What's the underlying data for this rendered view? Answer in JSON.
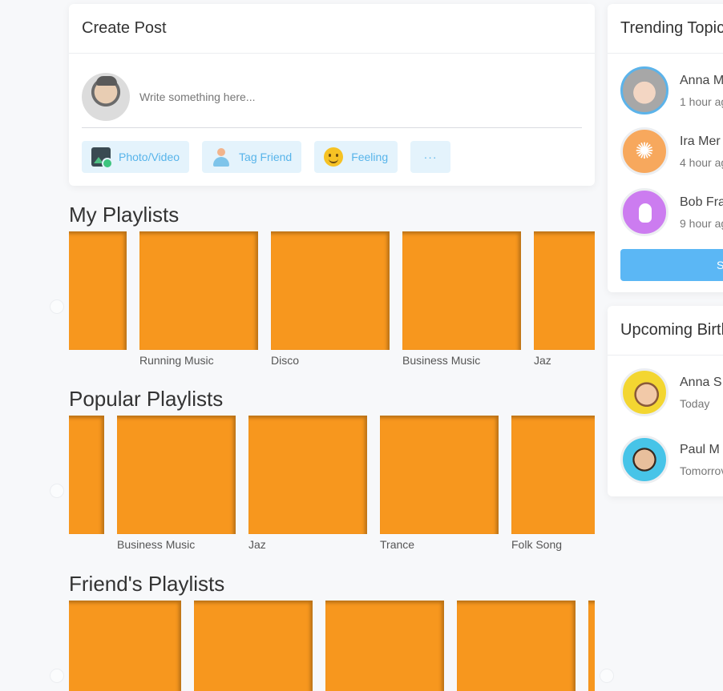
{
  "create_post": {
    "title": "Create Post",
    "input_placeholder": "Write something here...",
    "actions": [
      {
        "label": "Photo/Video",
        "icon": "photo-video-icon"
      },
      {
        "label": "Tag Friend",
        "icon": "tag-friend-icon"
      },
      {
        "label": "Feeling",
        "icon": "feeling-icon"
      },
      {
        "label": "···",
        "icon": "more-icon"
      }
    ]
  },
  "my_playlists": {
    "title": "My Playlists",
    "items": [
      "",
      "Running Music",
      "Disco",
      "Business Music",
      "Jaz"
    ]
  },
  "popular_playlists": {
    "title": "Popular Playlists",
    "items": [
      "",
      "Business Music",
      "Jaz",
      "Trance",
      "Folk Song"
    ]
  },
  "friends_playlists": {
    "title": "Friend's Playlists",
    "items": [
      "",
      "",
      "",
      "",
      ""
    ]
  },
  "trending": {
    "title": "Trending Topic",
    "people": [
      {
        "name": "Anna M",
        "sub": "1 hour ag"
      },
      {
        "name": "Ira Mer",
        "sub": "4 hour ag"
      },
      {
        "name": "Bob Fra",
        "sub": "9 hour ag"
      }
    ],
    "button_label": "S"
  },
  "birthdays": {
    "title": "Upcoming Birth",
    "people": [
      {
        "name": "Anna S",
        "sub": "Today"
      },
      {
        "name": "Paul M",
        "sub": "Tomorrov"
      }
    ]
  },
  "colors": {
    "accent": "#5bb7f5",
    "playlist_cover": "#f7971e",
    "action_bg": "#e4f3fc"
  }
}
